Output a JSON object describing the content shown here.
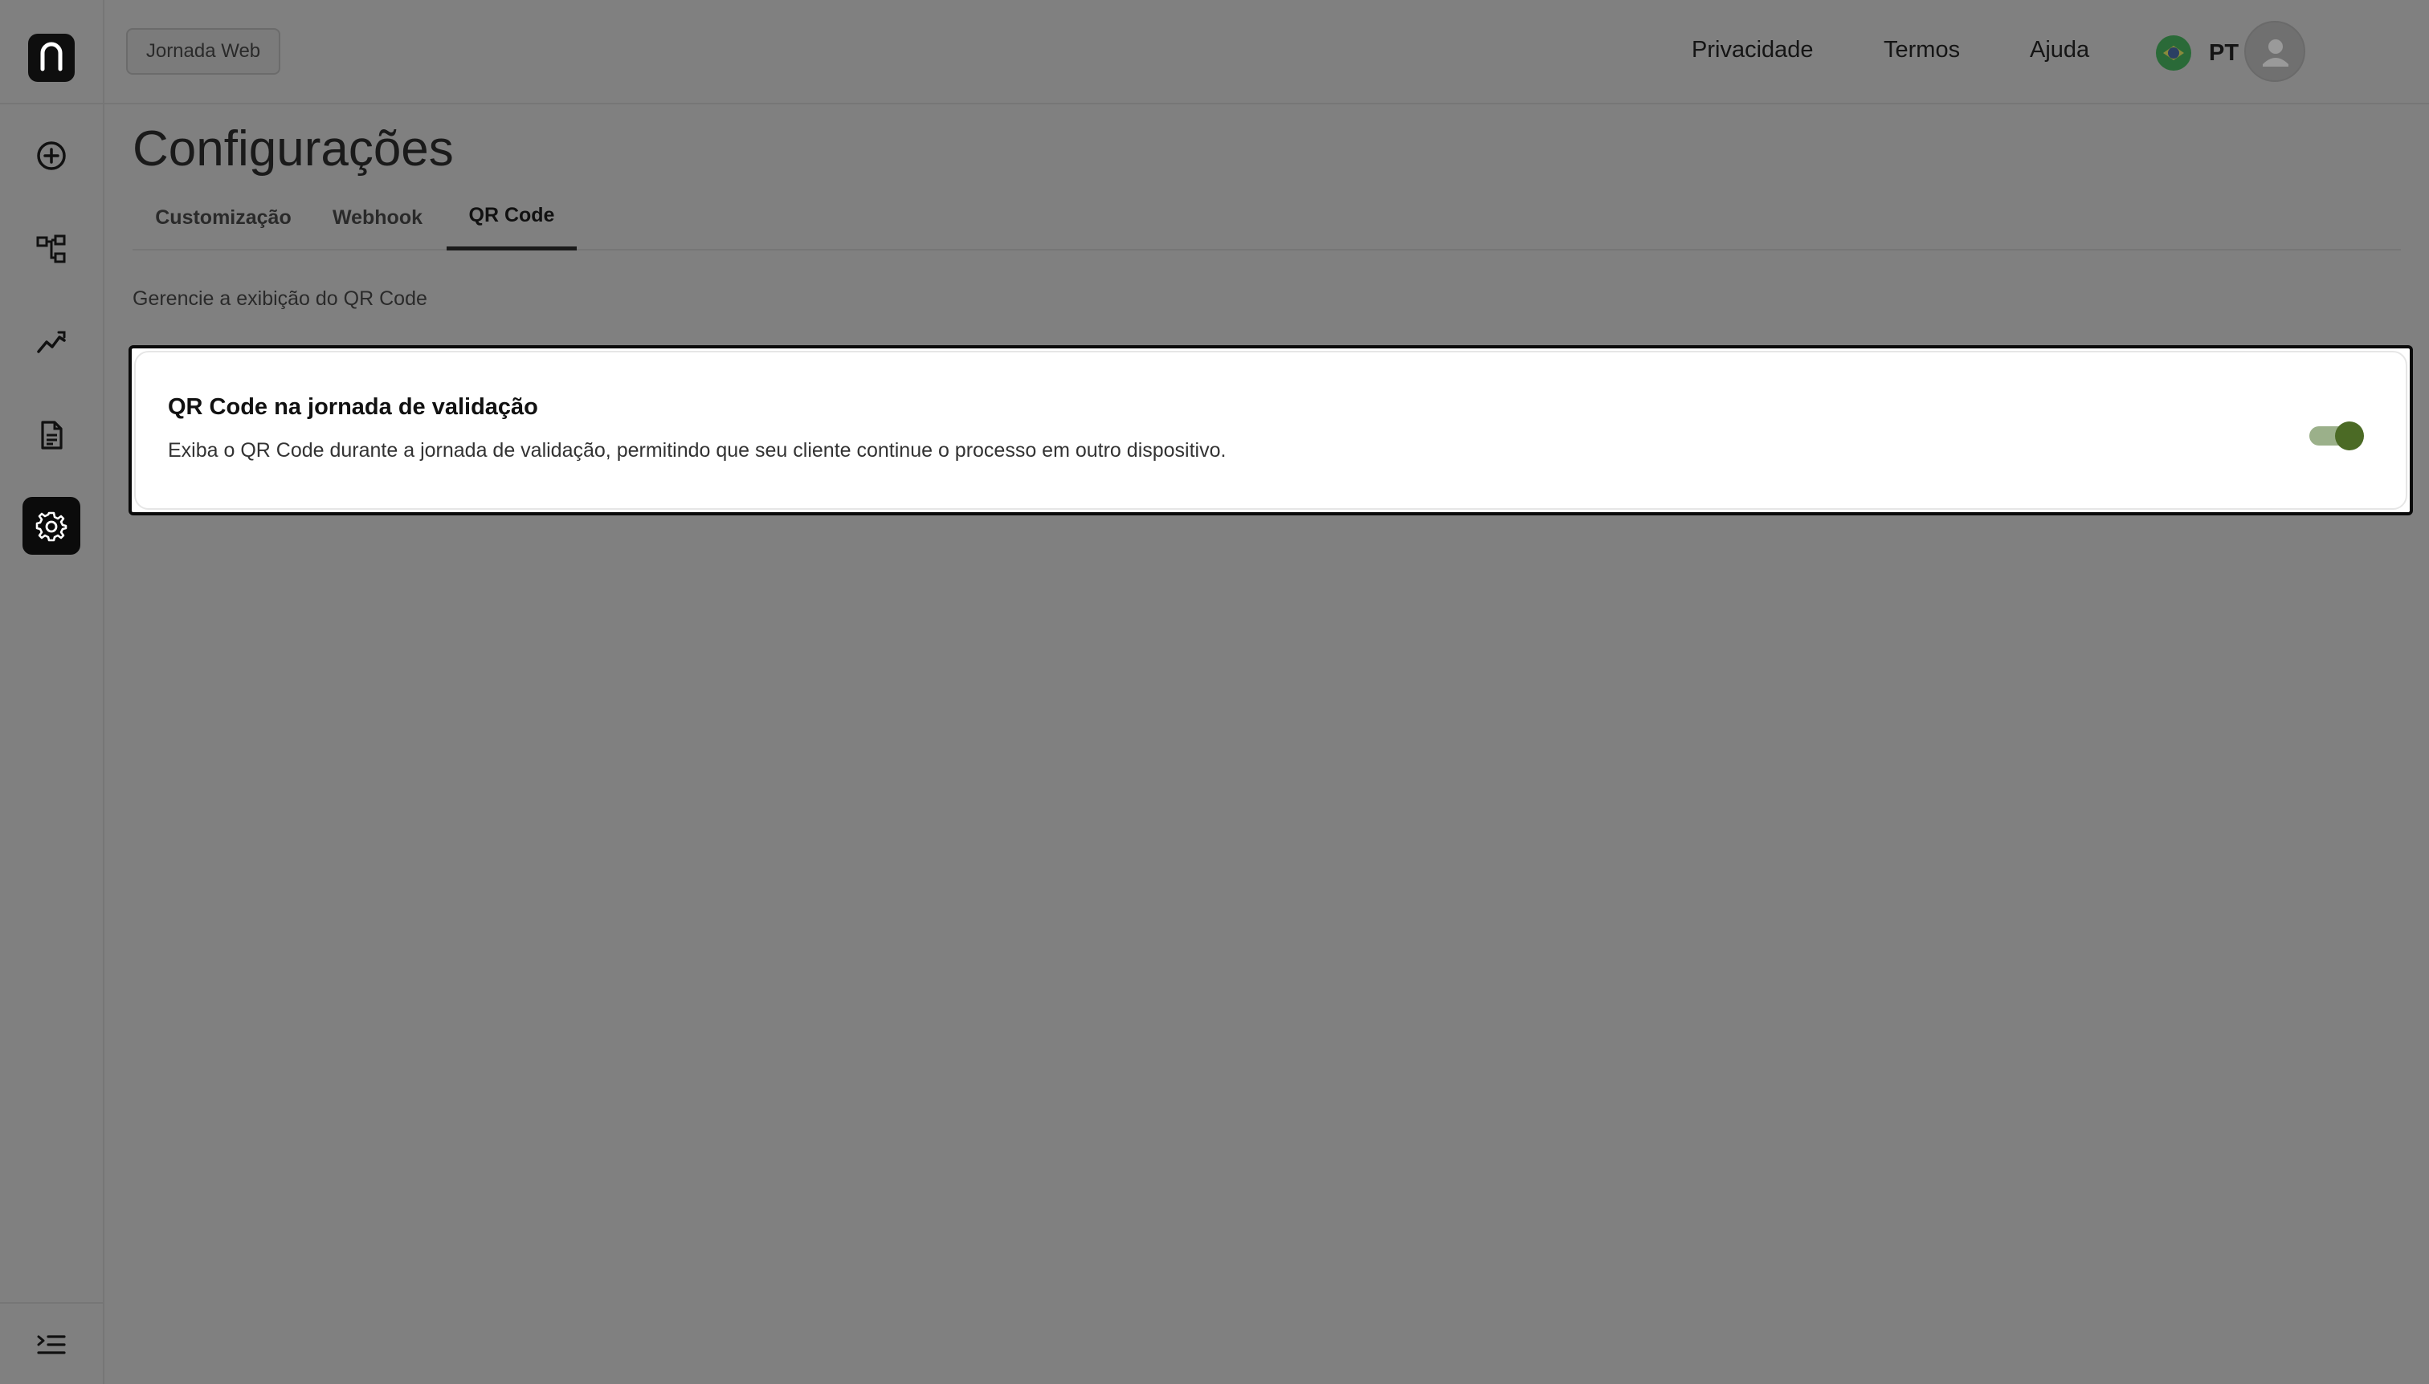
{
  "app": {
    "badge": "Jornada Web"
  },
  "header": {
    "links": [
      "Privacidade",
      "Termos",
      "Ajuda"
    ],
    "language": "PT"
  },
  "sidebar": {
    "items": [
      {
        "icon": "add-circle-icon"
      },
      {
        "icon": "flow-icon"
      },
      {
        "icon": "analytics-icon"
      },
      {
        "icon": "document-icon"
      },
      {
        "icon": "gear-icon",
        "active": true
      }
    ]
  },
  "page": {
    "title": "Configurações",
    "tabs": [
      "Customização",
      "Webhook",
      "QR Code"
    ],
    "active_tab": "QR Code",
    "subtitle": "Gerencie a exibição do QR Code"
  },
  "card": {
    "title": "QR Code na jornada de validação",
    "description": "Exiba o QR Code durante a jornada de validação, permitindo que seu cliente continue o processo em outro dispositivo.",
    "toggle_on": true
  },
  "colors": {
    "background": "#808080",
    "toggle_track": "#9bb08a",
    "toggle_knob": "#4b6a25",
    "active_nav": "#0b0b0b"
  }
}
